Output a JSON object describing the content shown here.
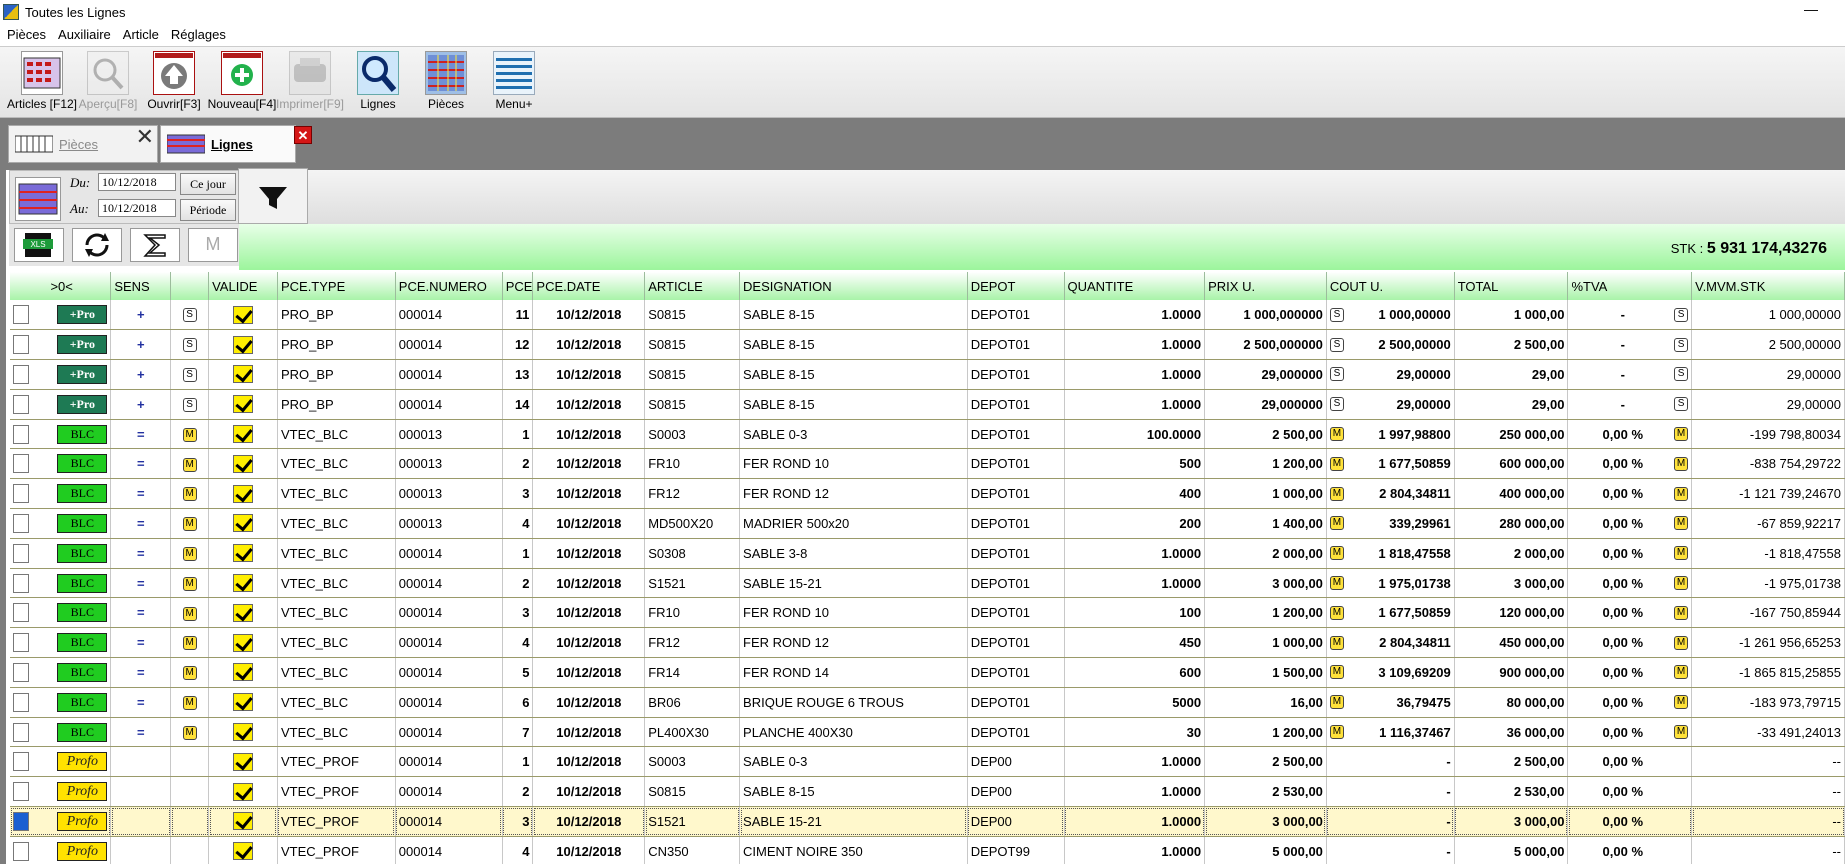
{
  "window": {
    "title": "Toutes les Lignes"
  },
  "menu": [
    "Pièces",
    "Auxiliaire",
    "Article",
    "Réglages"
  ],
  "toolbar": [
    {
      "label": "Articles [F12]",
      "icon": "articles-grid-icon",
      "enabled": true
    },
    {
      "label": "Aperçu[F8]",
      "icon": "preview-magnifier-icon",
      "enabled": false
    },
    {
      "label": "Ouvrir[F3]",
      "icon": "open-arrow-up-icon",
      "enabled": true
    },
    {
      "label": "Nouveau[F4]",
      "icon": "new-plus-icon",
      "enabled": true
    },
    {
      "label": "Imprimer[F9]",
      "icon": "printer-icon",
      "enabled": false
    },
    {
      "label": "Lignes",
      "icon": "search-magnifier-icon",
      "enabled": true
    },
    {
      "label": "Pièces",
      "icon": "pieces-grid-icon",
      "enabled": true
    },
    {
      "label": "Menu+",
      "icon": "menu-lines-icon",
      "enabled": true
    }
  ],
  "tabs": [
    {
      "label": "Pièces",
      "active": false
    },
    {
      "label": "Lignes",
      "active": true
    }
  ],
  "filter": {
    "du_label": "Du:",
    "au_label": "Au:",
    "du_value": "10/12/2018",
    "au_value": "10/12/2018",
    "ce_jour": "Ce jour",
    "periode": "Période"
  },
  "actions": {
    "m_label": "M"
  },
  "stk": {
    "label": "STK :",
    "value": "5 931 174,43276"
  },
  "grid": {
    "columns": [
      ">0<",
      "SENS",
      "",
      "VALIDE",
      "PCE.TYPE",
      "PCE.NUMERO",
      "PCE",
      "PCE.DATE",
      "ARTICLE",
      "DESIGNATION",
      "DEPOT",
      "QUANTITE",
      "PRIX U.",
      "COUT U.",
      "TOTAL",
      "%TVA",
      "V.MVM.STK"
    ],
    "rows": [
      {
        "badge": "+Pro",
        "kind": "pro",
        "sens": "+",
        "mark": "S",
        "type": "PRO_BP",
        "numero": "000014",
        "pce": "11",
        "date": "10/12/2018",
        "article": "S0815",
        "designation": "SABLE 8-15",
        "depot": "DEPOT01",
        "quantite": "1.0000",
        "prix": "1 000,000000",
        "cout_mark": "S",
        "cout": "1 000,00000",
        "total": "1 000,00",
        "tva": "-",
        "vmark": "S",
        "vmvm": "1 000,00000"
      },
      {
        "badge": "+Pro",
        "kind": "pro",
        "sens": "+",
        "mark": "S",
        "type": "PRO_BP",
        "numero": "000014",
        "pce": "12",
        "date": "10/12/2018",
        "article": "S0815",
        "designation": "SABLE 8-15",
        "depot": "DEPOT01",
        "quantite": "1.0000",
        "prix": "2 500,000000",
        "cout_mark": "S",
        "cout": "2 500,00000",
        "total": "2 500,00",
        "tva": "-",
        "vmark": "S",
        "vmvm": "2 500,00000"
      },
      {
        "badge": "+Pro",
        "kind": "pro",
        "sens": "+",
        "mark": "S",
        "type": "PRO_BP",
        "numero": "000014",
        "pce": "13",
        "date": "10/12/2018",
        "article": "S0815",
        "designation": "SABLE 8-15",
        "depot": "DEPOT01",
        "quantite": "1.0000",
        "prix": "29,000000",
        "cout_mark": "S",
        "cout": "29,00000",
        "total": "29,00",
        "tva": "-",
        "vmark": "S",
        "vmvm": "29,00000"
      },
      {
        "badge": "+Pro",
        "kind": "pro",
        "sens": "+",
        "mark": "S",
        "type": "PRO_BP",
        "numero": "000014",
        "pce": "14",
        "date": "10/12/2018",
        "article": "S0815",
        "designation": "SABLE 8-15",
        "depot": "DEPOT01",
        "quantite": "1.0000",
        "prix": "29,000000",
        "cout_mark": "S",
        "cout": "29,00000",
        "total": "29,00",
        "tva": "-",
        "vmark": "S",
        "vmvm": "29,00000"
      },
      {
        "badge": "BLC",
        "kind": "blc",
        "sens": "=",
        "mark": "M",
        "type": "VTEC_BLC",
        "numero": "000013",
        "pce": "1",
        "date": "10/12/2018",
        "article": "S0003",
        "designation": "SABLE 0-3",
        "depot": "DEPOT01",
        "quantite": "100.0000",
        "prix": "2 500,00",
        "cout_mark": "M",
        "cout": "1 997,98800",
        "total": "250 000,00",
        "tva": "0,00 %",
        "vmark": "M",
        "vmvm": "-199 798,80034"
      },
      {
        "badge": "BLC",
        "kind": "blc",
        "sens": "=",
        "mark": "M",
        "type": "VTEC_BLC",
        "numero": "000013",
        "pce": "2",
        "date": "10/12/2018",
        "article": "FR10",
        "designation": "FER ROND 10",
        "depot": "DEPOT01",
        "quantite": "500",
        "prix": "1 200,00",
        "cout_mark": "M",
        "cout": "1 677,50859",
        "total": "600 000,00",
        "tva": "0,00 %",
        "vmark": "M",
        "vmvm": "-838 754,29722"
      },
      {
        "badge": "BLC",
        "kind": "blc",
        "sens": "=",
        "mark": "M",
        "type": "VTEC_BLC",
        "numero": "000013",
        "pce": "3",
        "date": "10/12/2018",
        "article": "FR12",
        "designation": "FER ROND 12",
        "depot": "DEPOT01",
        "quantite": "400",
        "prix": "1 000,00",
        "cout_mark": "M",
        "cout": "2 804,34811",
        "total": "400 000,00",
        "tva": "0,00 %",
        "vmark": "M",
        "vmvm": "-1 121 739,24670"
      },
      {
        "badge": "BLC",
        "kind": "blc",
        "sens": "=",
        "mark": "M",
        "type": "VTEC_BLC",
        "numero": "000013",
        "pce": "4",
        "date": "10/12/2018",
        "article": "MD500X20",
        "designation": "MADRIER 500x20",
        "depot": "DEPOT01",
        "quantite": "200",
        "prix": "1 400,00",
        "cout_mark": "M",
        "cout": "339,29961",
        "total": "280 000,00",
        "tva": "0,00 %",
        "vmark": "M",
        "vmvm": "-67 859,92217"
      },
      {
        "badge": "BLC",
        "kind": "blc",
        "sens": "=",
        "mark": "M",
        "type": "VTEC_BLC",
        "numero": "000014",
        "pce": "1",
        "date": "10/12/2018",
        "article": "S0308",
        "designation": "SABLE 3-8",
        "depot": "DEPOT01",
        "quantite": "1.0000",
        "prix": "2 000,00",
        "cout_mark": "M",
        "cout": "1 818,47558",
        "total": "2 000,00",
        "tva": "0,00 %",
        "vmark": "M",
        "vmvm": "-1 818,47558"
      },
      {
        "badge": "BLC",
        "kind": "blc",
        "sens": "=",
        "mark": "M",
        "type": "VTEC_BLC",
        "numero": "000014",
        "pce": "2",
        "date": "10/12/2018",
        "article": "S1521",
        "designation": "SABLE 15-21",
        "depot": "DEPOT01",
        "quantite": "1.0000",
        "prix": "3 000,00",
        "cout_mark": "M",
        "cout": "1 975,01738",
        "total": "3 000,00",
        "tva": "0,00 %",
        "vmark": "M",
        "vmvm": "-1 975,01738"
      },
      {
        "badge": "BLC",
        "kind": "blc",
        "sens": "=",
        "mark": "M",
        "type": "VTEC_BLC",
        "numero": "000014",
        "pce": "3",
        "date": "10/12/2018",
        "article": "FR10",
        "designation": "FER ROND 10",
        "depot": "DEPOT01",
        "quantite": "100",
        "prix": "1 200,00",
        "cout_mark": "M",
        "cout": "1 677,50859",
        "total": "120 000,00",
        "tva": "0,00 %",
        "vmark": "M",
        "vmvm": "-167 750,85944"
      },
      {
        "badge": "BLC",
        "kind": "blc",
        "sens": "=",
        "mark": "M",
        "type": "VTEC_BLC",
        "numero": "000014",
        "pce": "4",
        "date": "10/12/2018",
        "article": "FR12",
        "designation": "FER ROND 12",
        "depot": "DEPOT01",
        "quantite": "450",
        "prix": "1 000,00",
        "cout_mark": "M",
        "cout": "2 804,34811",
        "total": "450 000,00",
        "tva": "0,00 %",
        "vmark": "M",
        "vmvm": "-1 261 956,65253"
      },
      {
        "badge": "BLC",
        "kind": "blc",
        "sens": "=",
        "mark": "M",
        "type": "VTEC_BLC",
        "numero": "000014",
        "pce": "5",
        "date": "10/12/2018",
        "article": "FR14",
        "designation": "FER ROND 14",
        "depot": "DEPOT01",
        "quantite": "600",
        "prix": "1 500,00",
        "cout_mark": "M",
        "cout": "3 109,69209",
        "total": "900 000,00",
        "tva": "0,00 %",
        "vmark": "M",
        "vmvm": "-1 865 815,25855"
      },
      {
        "badge": "BLC",
        "kind": "blc",
        "sens": "=",
        "mark": "M",
        "type": "VTEC_BLC",
        "numero": "000014",
        "pce": "6",
        "date": "10/12/2018",
        "article": "BR06",
        "designation": "BRIQUE ROUGE 6 TROUS",
        "depot": "DEPOT01",
        "quantite": "5000",
        "prix": "16,00",
        "cout_mark": "M",
        "cout": "36,79475",
        "total": "80 000,00",
        "tva": "0,00 %",
        "vmark": "M",
        "vmvm": "-183 973,79715"
      },
      {
        "badge": "BLC",
        "kind": "blc",
        "sens": "=",
        "mark": "M",
        "type": "VTEC_BLC",
        "numero": "000014",
        "pce": "7",
        "date": "10/12/2018",
        "article": "PL400X30",
        "designation": "PLANCHE 400X30",
        "depot": "DEPOT01",
        "quantite": "30",
        "prix": "1 200,00",
        "cout_mark": "M",
        "cout": "1 116,37467",
        "total": "36 000,00",
        "tva": "0,00 %",
        "vmark": "M",
        "vmvm": "-33 491,24013"
      },
      {
        "badge": "Profo",
        "kind": "profo",
        "sens": "",
        "mark": "",
        "type": "VTEC_PROF",
        "numero": "000014",
        "pce": "1",
        "date": "10/12/2018",
        "article": "S0003",
        "designation": "SABLE 0-3",
        "depot": "DEP00",
        "quantite": "1.0000",
        "prix": "2 500,00",
        "cout_mark": "",
        "cout": "-",
        "total": "2 500,00",
        "tva": "0,00 %",
        "vmark": "",
        "vmvm": "--"
      },
      {
        "badge": "Profo",
        "kind": "profo",
        "sens": "",
        "mark": "",
        "type": "VTEC_PROF",
        "numero": "000014",
        "pce": "2",
        "date": "10/12/2018",
        "article": "S0815",
        "designation": "SABLE 8-15",
        "depot": "DEP00",
        "quantite": "1.0000",
        "prix": "2 530,00",
        "cout_mark": "",
        "cout": "-",
        "total": "2 530,00",
        "tva": "0,00 %",
        "vmark": "",
        "vmvm": "--"
      },
      {
        "badge": "Profo",
        "kind": "profo",
        "sens": "",
        "mark": "",
        "type": "VTEC_PROF",
        "numero": "000014",
        "pce": "3",
        "date": "10/12/2018",
        "article": "S1521",
        "designation": "SABLE 15-21",
        "depot": "DEP00",
        "quantite": "1.0000",
        "prix": "3 000,00",
        "cout_mark": "",
        "cout": "-",
        "total": "3 000,00",
        "tva": "0,00 %",
        "vmark": "",
        "vmvm": "--",
        "selected": true
      },
      {
        "badge": "Profo",
        "kind": "profo",
        "sens": "",
        "mark": "",
        "type": "VTEC_PROF",
        "numero": "000014",
        "pce": "4",
        "date": "10/12/2018",
        "article": "CN350",
        "designation": "CIMENT NOIRE 350",
        "depot": "DEPOT99",
        "quantite": "1.0000",
        "prix": "5 000,00",
        "cout_mark": "",
        "cout": "-",
        "total": "5 000,00",
        "tva": "0,00 %",
        "vmark": "",
        "vmvm": "--"
      }
    ]
  }
}
